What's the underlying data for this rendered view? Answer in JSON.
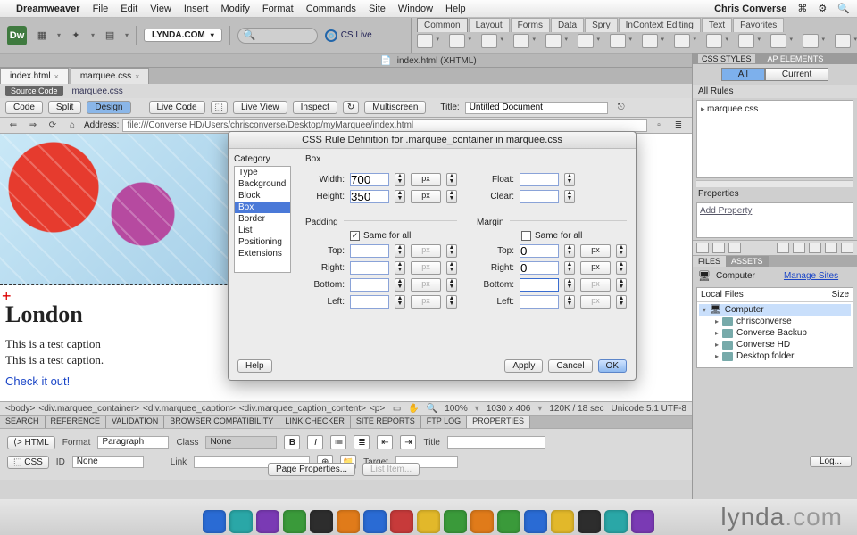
{
  "mac_menu": {
    "app": "Dreamweaver",
    "items": [
      "File",
      "Edit",
      "View",
      "Insert",
      "Modify",
      "Format",
      "Commands",
      "Site",
      "Window",
      "Help"
    ],
    "user": "Chris Converse"
  },
  "workspace": {
    "name": "LYNDA.COM",
    "cslive": "CS Live"
  },
  "insert_panel": {
    "tabs": [
      "Common",
      "Layout",
      "Forms",
      "Data",
      "Spry",
      "InContext Editing",
      "Text",
      "Favorites"
    ]
  },
  "doc_titlebar": "index.html (XHTML)",
  "file_tabs": [
    {
      "name": "index.html",
      "active": true
    },
    {
      "name": "marquee.css",
      "active": false
    }
  ],
  "source_row": {
    "btn": "Source Code",
    "linked": "marquee.css"
  },
  "view_toolbar": {
    "modes": [
      "Code",
      "Split",
      "Design"
    ],
    "mode_active": "Design",
    "btns": [
      "Live Code",
      "Live View",
      "Inspect",
      "Multiscreen"
    ],
    "title_label": "Title:",
    "title_value": "Untitled Document"
  },
  "address_bar": {
    "label": "Address:",
    "value": "file:///Converse HD/Users/chrisconverse/Desktop/myMarquee/index.html"
  },
  "canvas": {
    "heading": "London",
    "captions": [
      "This is a test caption",
      "This is a test caption."
    ],
    "link": "Check it out!"
  },
  "breadcrumb": {
    "path": [
      "<body>",
      "<div.marquee_container>",
      "<div.marquee_caption>",
      "<div.marquee_caption_content>",
      "<p>"
    ],
    "zoom": "100%",
    "dims": "1030 x 406",
    "size": "120K / 18 sec",
    "enc": "Unicode 5.1 UTF-8"
  },
  "lower_tabs": [
    "SEARCH",
    "REFERENCE",
    "VALIDATION",
    "BROWSER COMPATIBILITY",
    "LINK CHECKER",
    "SITE REPORTS",
    "FTP LOG",
    "PROPERTIES"
  ],
  "properties": {
    "left_tabs": [
      "HTML",
      "CSS"
    ],
    "format_label": "Format",
    "format_value": "Paragraph",
    "class_label": "Class",
    "class_value": "None",
    "id_label": "ID",
    "id_value": "None",
    "link_label": "Link",
    "link_value": "",
    "title_label": "Title",
    "title_value": "",
    "target_label": "Target",
    "target_value": "",
    "page_props": "Page Properties...",
    "list_item": "List Item..."
  },
  "right": {
    "css_tabs": [
      "CSS STYLES",
      "AP ELEMENTS"
    ],
    "seg": [
      "All",
      "Current"
    ],
    "seg_active": "All",
    "all_rules": "All Rules",
    "rule_item": "marquee.css",
    "props_title": "Properties",
    "add_prop": "Add Property",
    "files_tabs": [
      "FILES",
      "ASSETS"
    ],
    "files_active": "FILES",
    "drive": "Computer",
    "manage": "Manage Sites",
    "cols": [
      "Local Files",
      "Size"
    ],
    "tree": [
      {
        "name": "Computer",
        "sel": true,
        "lvl": 0
      },
      {
        "name": "chrisconverse",
        "lvl": 1
      },
      {
        "name": "Converse Backup",
        "lvl": 1
      },
      {
        "name": "Converse HD",
        "lvl": 1
      },
      {
        "name": "Desktop folder",
        "lvl": 1
      }
    ],
    "log": "Log..."
  },
  "dialog": {
    "title": "CSS Rule Definition for .marquee_container in marquee.css",
    "category_label": "Category",
    "categories": [
      "Type",
      "Background",
      "Block",
      "Box",
      "Border",
      "List",
      "Positioning",
      "Extensions"
    ],
    "category_selected": "Box",
    "section_label": "Box",
    "width_label": "Width:",
    "width_value": "700",
    "width_unit": "px",
    "height_label": "Height:",
    "height_value": "350",
    "height_unit": "px",
    "float_label": "Float:",
    "float_value": "",
    "clear_label": "Clear:",
    "clear_value": "",
    "padding_label": "Padding",
    "margin_label": "Margin",
    "same_label": "Same for all",
    "padding_same": true,
    "margin_same": false,
    "sides": [
      "Top:",
      "Right:",
      "Bottom:",
      "Left:"
    ],
    "margin_top": "0",
    "margin_right": "0",
    "buttons": {
      "help": "Help",
      "apply": "Apply",
      "cancel": "Cancel",
      "ok": "OK"
    }
  },
  "watermark": "lynda.com"
}
